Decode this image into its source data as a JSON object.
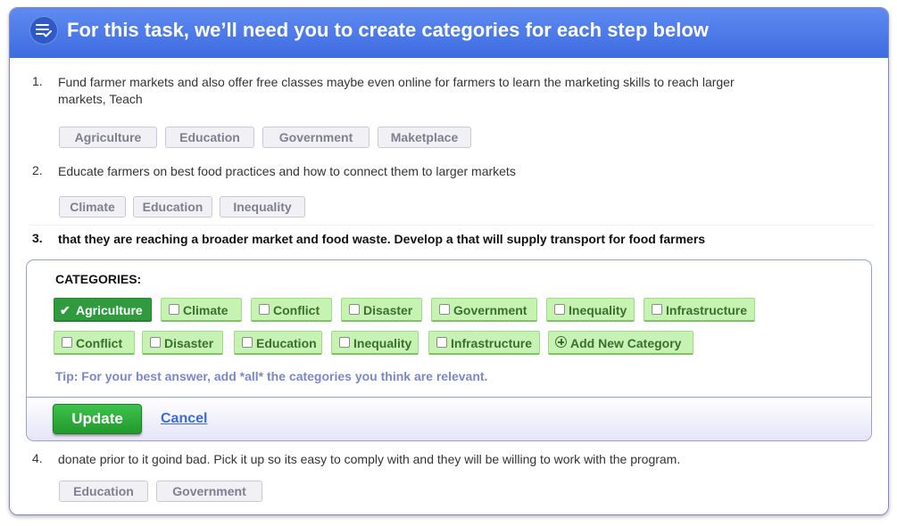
{
  "header": {
    "icon": "checklist-icon",
    "title": "For this task, we’ll need you to create categories for each step below"
  },
  "steps": [
    {
      "number": "1.",
      "text": "Fund farmer markets and also offer free classes maybe even online for farmers to learn the marketing skills to reach larger markets, Teach",
      "tags": [
        "Agriculture",
        "Education",
        "Government",
        "Maketplace"
      ]
    },
    {
      "number": "2.",
      "text": "Educate farmers on best food practices and how to connect them to larger markets",
      "tags": [
        "Climate",
        "Education",
        "Inequality"
      ]
    },
    {
      "number": "3.",
      "text": "that they are reaching a broader market and food waste. Develop a that will supply transport for food farmers"
    },
    {
      "number": "4.",
      "text": "donate prior to it goind bad. Pick it up so its easy to comply with and they will be willing to work with the program.",
      "tags": [
        "Education",
        "Government"
      ]
    }
  ],
  "editor": {
    "title": "CATEGORIES:",
    "selected_check": "✔",
    "categories_row1": [
      "Agriculture",
      "Climate",
      "Conflict",
      "Disaster",
      "Government",
      "Inequality",
      "Infrastructure"
    ],
    "categories_row2": [
      "Conflict",
      "Disaster",
      "Education",
      "Inequality",
      "Infrastructure"
    ],
    "selected": [
      "Agriculture"
    ],
    "add_new_label": "Add New Category",
    "tip": "Tip: For your best answer, add *all* the categories you think are relevant.",
    "update_label": "Update",
    "cancel_label": "Cancel"
  },
  "colors": {
    "header_blue": "#4a78e6",
    "category_green": "#c7f3b2",
    "selected_green": "#2f9a3e",
    "tip_color": "#7b88c8",
    "link_blue": "#3b6cd9"
  }
}
